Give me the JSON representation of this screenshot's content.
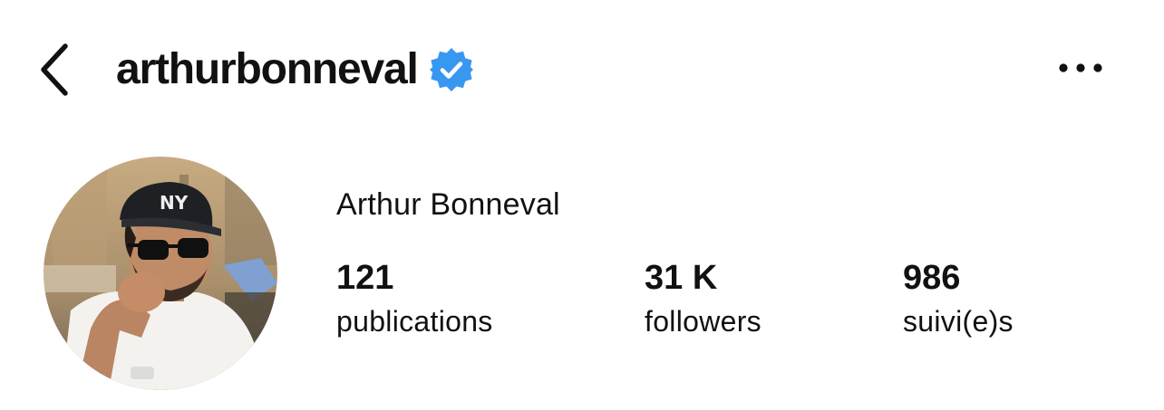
{
  "header": {
    "username": "arthurbonneval",
    "back_icon": "chevron-left-icon",
    "verified_icon": "verified-badge-icon",
    "more_icon": "more-horizontal-icon"
  },
  "profile": {
    "full_name": "Arthur Bonneval",
    "avatar_icon": "profile-photo"
  },
  "stats": {
    "publications": {
      "value": "121",
      "label": "publications"
    },
    "followers": {
      "value": "31 K",
      "label": "followers"
    },
    "following": {
      "value": "986",
      "label": "suivi(e)s"
    }
  },
  "colors": {
    "verified": "#3897F0",
    "text": "#111111",
    "background": "#FFFFFF"
  }
}
